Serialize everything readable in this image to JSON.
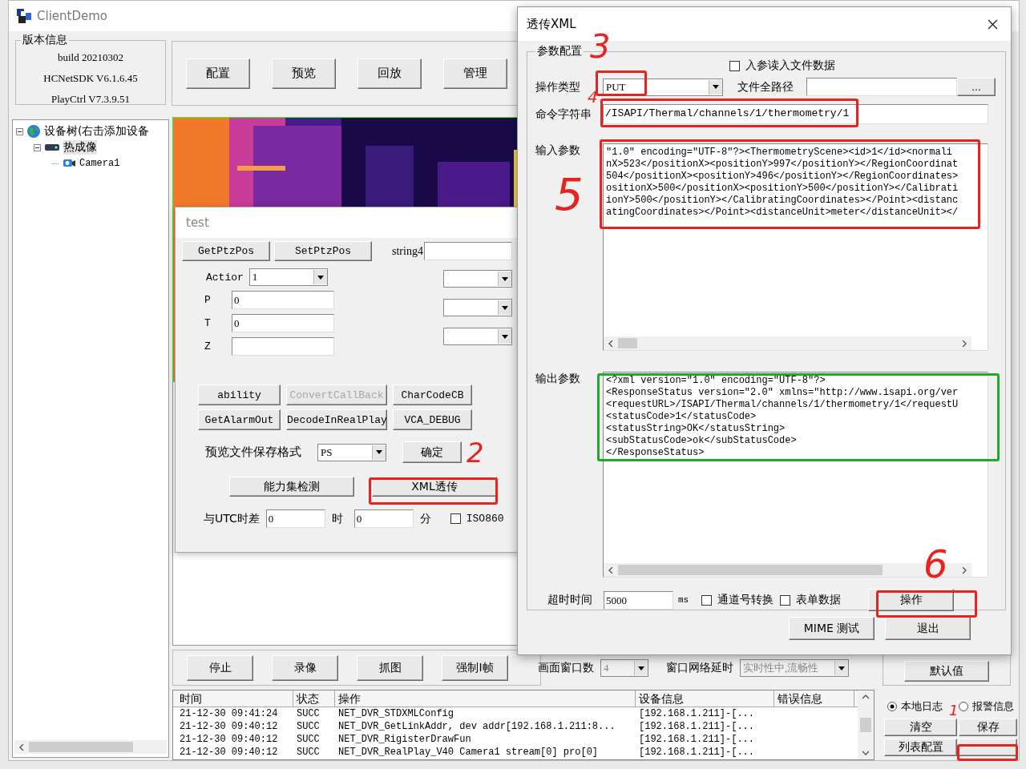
{
  "main_window": {
    "title": "ClientDemo"
  },
  "version_info": {
    "title": "版本信息",
    "lines": [
      "build 20210302",
      "HCNetSDK V6.1.6.45",
      "PlayCtrl V7.3.9.51"
    ]
  },
  "top_buttons": [
    "配置",
    "预览",
    "回放",
    "管理"
  ],
  "device_tree": [
    {
      "label": "设备树(右击添加设备",
      "kind": "root",
      "expanded": true,
      "selected": false,
      "children": [
        {
          "label": "热成像",
          "kind": "device",
          "expanded": true,
          "selected": true,
          "children": [
            {
              "label": "Camera1",
              "kind": "camera",
              "selected": false
            }
          ]
        }
      ]
    }
  ],
  "video": {
    "kind": "picture"
  },
  "preview_buttons": [
    "停止",
    "录像",
    "抓图",
    "强制I帧"
  ],
  "window_count": {
    "label": "画面窗口数",
    "value": "4"
  },
  "net_delay": {
    "label": "窗口网络延时",
    "value": "实时性中,流畅性"
  },
  "default_button": "默认值",
  "log_table": {
    "columns": [
      "时间",
      "状态",
      "操作",
      "设备信息",
      "错误信息"
    ],
    "rows": [
      [
        "21-12-30 09:41:24",
        "SUCC",
        "NET_DVR_STDXMLConfig",
        "[192.168.1.211]-[..."
      ],
      [
        "21-12-30 09:40:12",
        "SUCC",
        "NET_DVR_GetLinkAddr, dev addr[192.168.1.211:8...",
        "[192.168.1.211]-[..."
      ],
      [
        "21-12-30 09:40:12",
        "SUCC",
        "NET_DVR_RigisterDrawFun",
        "[192.168.1.211]-[..."
      ],
      [
        "21-12-30 09:40:12",
        "SUCC",
        "NET_DVR_RealPlay_V40 Camera1 stream[0] pro[0]",
        "[192.168.1.211]-[..."
      ]
    ]
  },
  "log_mode": [
    {
      "label": "本地日志",
      "selected": true
    },
    {
      "label": "报警信息",
      "selected": false
    }
  ],
  "log_buttons": [
    "清空",
    "保存",
    "列表配置"
  ],
  "test_dialog": {
    "title": "test",
    "ptz_buttons": [
      "GetPtzPos",
      "SetPtzPos"
    ],
    "string4": {
      "label": "string4"
    },
    "action": {
      "label": "Actior",
      "value": "1"
    },
    "fields": [
      {
        "label": "P",
        "value": "0"
      },
      {
        "label": "T",
        "value": "0"
      },
      {
        "label": "Z"
      }
    ],
    "tool_buttons": [
      {
        "label": "ability",
        "disabled": false
      },
      {
        "label": "ConvertCallBack",
        "disabled": true
      },
      {
        "label": "CharCodeCB",
        "disabled": false
      },
      {
        "label": "GetAlarmOut",
        "disabled": false
      },
      {
        "label": "DecodeInRealPlay",
        "disabled": false
      },
      {
        "label": "VCA_DEBUG",
        "disabled": false
      }
    ],
    "save_format": {
      "label": "预览文件保存格式",
      "value": "PS",
      "button": "确定"
    },
    "ability_button": "能力集检测",
    "xml_button": "XML透传",
    "utc": {
      "label": "与UTC时差",
      "hours": "0",
      "hours_unit": "时",
      "minutes": "0",
      "minutes_unit": "分",
      "iso_label": "ISO860",
      "iso_checked": false
    }
  },
  "xml_dialog": {
    "title": "透传XML",
    "group_title": "参数配置",
    "read_file": {
      "label": "入参读入文件数据",
      "checked": false
    },
    "op_type": {
      "label": "操作类型",
      "value": "PUT"
    },
    "file_path": {
      "label": "文件全路径",
      "browse": "..."
    },
    "command": {
      "label": "命令字符串",
      "value": "/ISAPI/Thermal/channels/1/thermometry/1"
    },
    "input": {
      "label": "输入参数",
      "lines": [
        "\"1.0\" encoding=\"UTF-8\"?><ThermometryScene><id>1</id><normali",
        "nX>523</positionX><positionY>997</positionY></RegionCoordinat",
        "504</positionX><positionY>496</positionY></RegionCoordinates>",
        "ositionX>500</positionX><positionY>500</positionY></Calibrati",
        "ionY>500</positionY></CalibratingCoordinates></Point><distanc",
        "atingCoordinates></Point><distanceUnit>meter</distanceUnit></"
      ]
    },
    "output": {
      "label": "输出参数",
      "lines": [
        "<?xml version=\"1.0\" encoding=\"UTF-8\"?>",
        "<ResponseStatus version=\"2.0\" xmlns=\"http://www.isapi.org/ver",
        "<requestURL>/ISAPI/Thermal/channels/1/thermometry/1</requestU",
        "<statusCode>1</statusCode>",
        "<statusString>OK</statusString>",
        "<subStatusCode>ok</subStatusCode>",
        "</ResponseStatus>"
      ]
    },
    "timeout": {
      "label": "超时时间",
      "value": "5000",
      "unit": "ms"
    },
    "options": [
      {
        "label": "通道号转换",
        "checked": false
      },
      {
        "label": "表单数据",
        "checked": false
      }
    ],
    "action_button": "操作",
    "mime_button": "MIME 测试",
    "exit_button": "退出"
  },
  "annotations": [
    {
      "kind": "box",
      "color": "#e8231f"
    },
    {
      "kind": "box",
      "color": "#e8231f"
    },
    {
      "kind": "box",
      "color": "#e8231f"
    },
    {
      "kind": "box",
      "color": "#e8231f"
    },
    {
      "kind": "box",
      "color": "#e8231f"
    },
    {
      "kind": "box",
      "color": "#e8231f"
    },
    {
      "kind": "box",
      "color": "#1fa82a"
    },
    {
      "kind": "number",
      "label": "1",
      "color": "#e8231f"
    },
    {
      "kind": "number",
      "label": "2",
      "color": "#e8231f"
    },
    {
      "kind": "number",
      "label": "3",
      "color": "#e8231f"
    },
    {
      "kind": "number",
      "label": "4",
      "color": "#e8231f"
    },
    {
      "kind": "number",
      "label": "5",
      "color": "#e8231f"
    },
    {
      "kind": "number",
      "label": "6",
      "color": "#e8231f"
    }
  ]
}
